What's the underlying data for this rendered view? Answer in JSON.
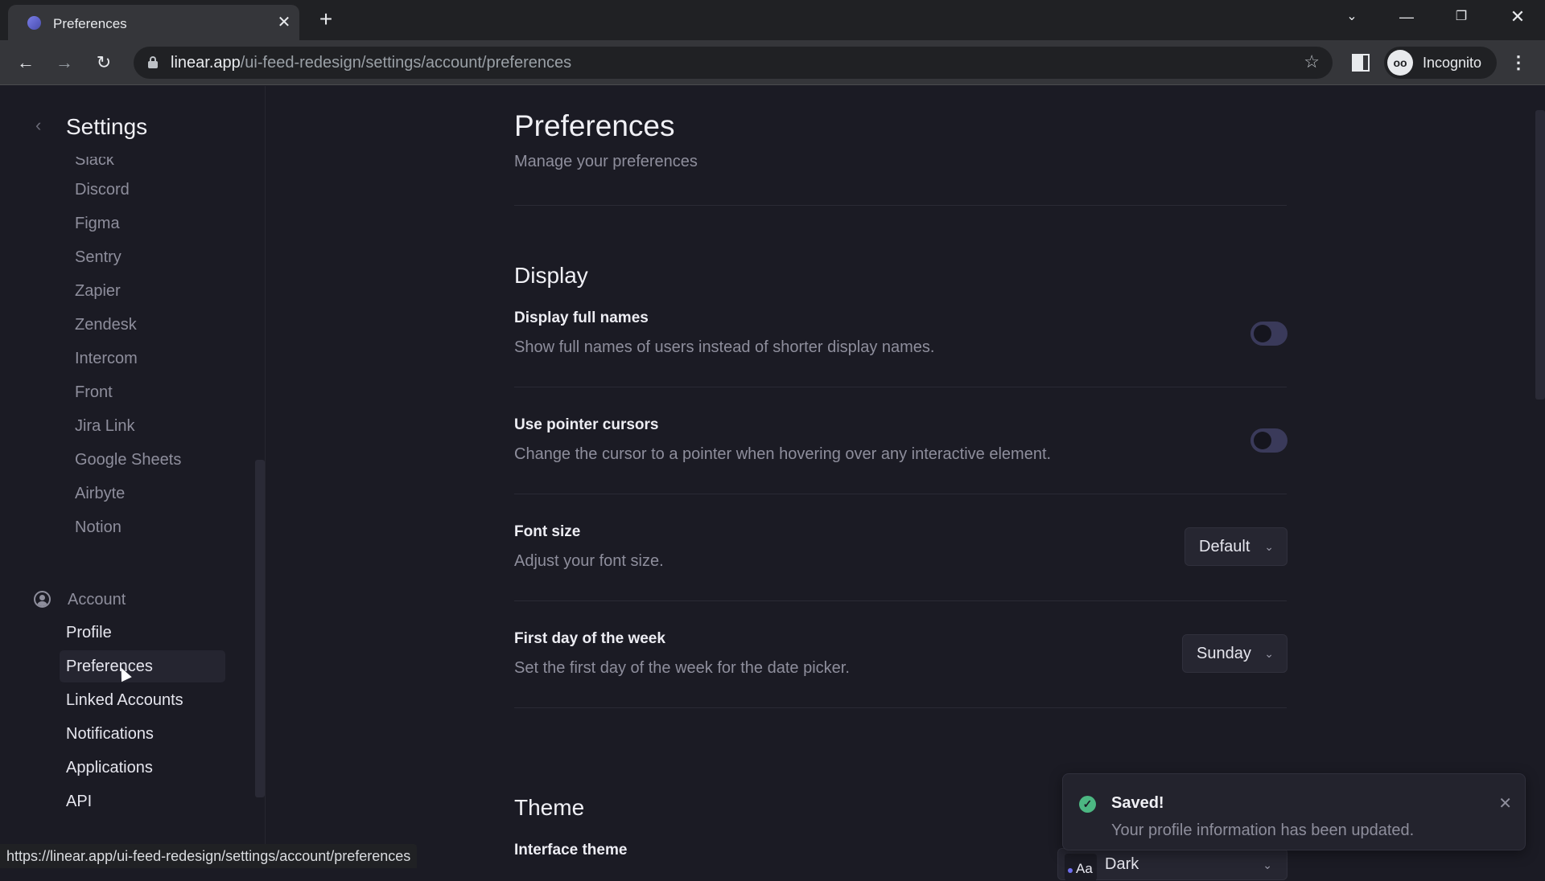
{
  "browser": {
    "tab_title": "Preferences",
    "url_host": "linear.app",
    "url_path": "/ui-feed-redesign/settings/account/preferences",
    "profile_label": "Incognito",
    "status_url": "https://linear.app/ui-feed-redesign/settings/account/preferences"
  },
  "sidebar": {
    "title": "Settings",
    "integrations": [
      {
        "label": "Slack"
      },
      {
        "label": "Discord"
      },
      {
        "label": "Figma"
      },
      {
        "label": "Sentry"
      },
      {
        "label": "Zapier"
      },
      {
        "label": "Zendesk"
      },
      {
        "label": "Intercom"
      },
      {
        "label": "Front"
      },
      {
        "label": "Jira Link"
      },
      {
        "label": "Google Sheets"
      },
      {
        "label": "Airbyte"
      },
      {
        "label": "Notion"
      }
    ],
    "account_section": "Account",
    "account_items": [
      {
        "label": "Profile",
        "active": false
      },
      {
        "label": "Preferences",
        "active": true
      },
      {
        "label": "Linked Accounts",
        "active": false
      },
      {
        "label": "Notifications",
        "active": false
      },
      {
        "label": "Applications",
        "active": false
      },
      {
        "label": "API",
        "active": false
      }
    ]
  },
  "main": {
    "title": "Preferences",
    "subtitle": "Manage your preferences",
    "display": {
      "heading": "Display",
      "rows": [
        {
          "label": "Display full names",
          "description": "Show full names of users instead of shorter display names.",
          "enabled": false
        },
        {
          "label": "Use pointer cursors",
          "description": "Change the cursor to a pointer when hovering over any interactive element.",
          "enabled": false
        },
        {
          "label": "Font size",
          "description": "Adjust your font size.",
          "value": "Default"
        },
        {
          "label": "First day of the week",
          "description": "Set the first day of the week for the date picker.",
          "value": "Sunday"
        }
      ]
    },
    "theme": {
      "heading": "Theme",
      "interface_label": "Interface theme",
      "swatch_text": "Aa",
      "value": "Dark"
    }
  },
  "toast": {
    "title": "Saved!",
    "message": "Your profile information has been updated."
  },
  "colors": {
    "background": "#1b1b24",
    "success": "#4cb782",
    "accent": "#6e6ef0"
  }
}
